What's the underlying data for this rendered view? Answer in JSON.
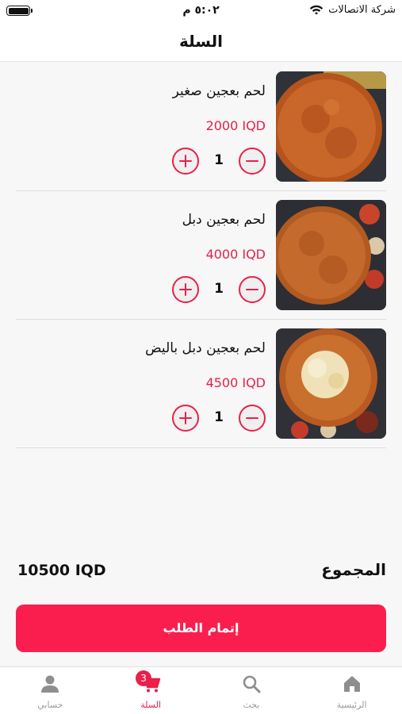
{
  "status_bar": {
    "time": "٥:٠٢ م",
    "carrier": "شركة الاتصالات"
  },
  "header": {
    "title": "السلة"
  },
  "cart": {
    "items": [
      {
        "name": "لحم بعجين صغير",
        "price": "2000 IQD",
        "quantity": "1",
        "image": "lahm-bi-ajeen-small-photo"
      },
      {
        "name": "لحم بعجين دبل",
        "price": "4000 IQD",
        "quantity": "1",
        "image": "lahm-bi-ajeen-double-photo"
      },
      {
        "name": "لحم بعجين دبل باليض",
        "price": "4500 IQD",
        "quantity": "1",
        "image": "lahm-bi-ajeen-double-egg-photo"
      }
    ]
  },
  "summary": {
    "total_label": "المجموع",
    "total_value": "10500 IQD",
    "checkout_label": "إتمام الطلب"
  },
  "bottom_nav": {
    "home": "الرئيسية",
    "search": "بحث",
    "cart": "السلة",
    "cart_badge": "3",
    "account": "حسابي"
  },
  "colors": {
    "accent": "#e8204a",
    "checkout_button": "#fa1e4e"
  }
}
